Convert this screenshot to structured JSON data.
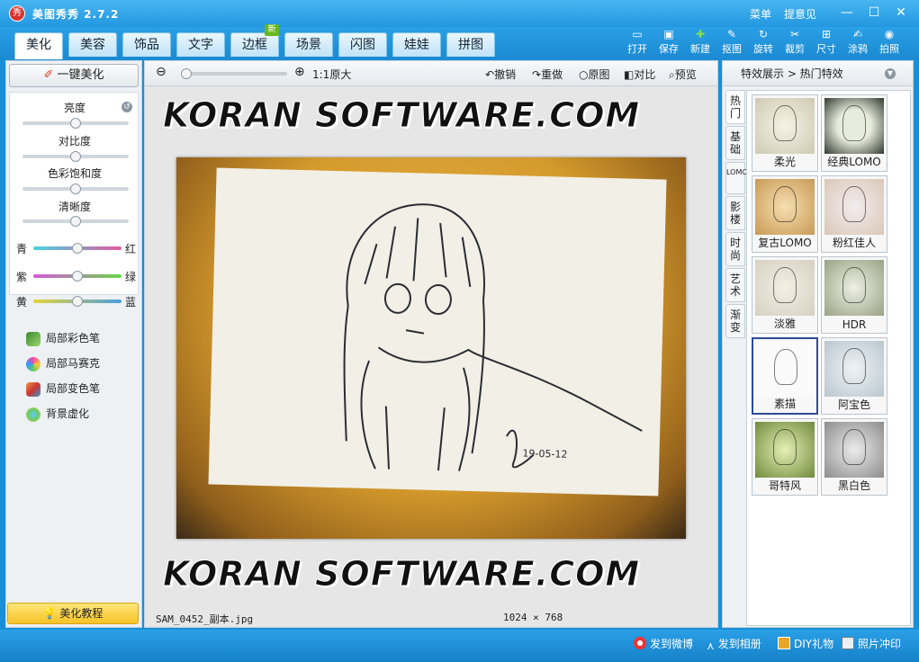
{
  "window": {
    "title": "美图秀秀 2.7.2",
    "logo_text": "秀",
    "menu_label": "菜单",
    "feedback_label": "提意见",
    "minimize": "—",
    "maximize": "☐",
    "close": "✕"
  },
  "tabs": [
    {
      "label": "美化"
    },
    {
      "label": "美容"
    },
    {
      "label": "饰品"
    },
    {
      "label": "文字"
    },
    {
      "label": "边框"
    },
    {
      "label": "场景"
    },
    {
      "label": "闪图"
    },
    {
      "label": "娃娃"
    },
    {
      "label": "拼图"
    }
  ],
  "new_badge": "新",
  "toolbar": {
    "open": "打开",
    "save": "保存",
    "new": "新建",
    "cutout": "抠图",
    "rotate": "旋转",
    "crop": "裁剪",
    "size": "尺寸",
    "doodle": "涂鸦",
    "photo": "拍照"
  },
  "left": {
    "one_key": "一键美化",
    "brightness": "亮度",
    "contrast": "对比度",
    "saturation": "色彩饱和度",
    "sharpness": "清晰度",
    "cyan": "青",
    "red": "红",
    "purple": "紫",
    "green": "绿",
    "yellow": "黄",
    "blue": "蓝",
    "tools": [
      "局部彩色笔",
      "局部马赛克",
      "局部变色笔",
      "背景虚化"
    ],
    "tutorial": "美化教程",
    "levels": {
      "brightness": 0.5,
      "contrast": 0.5,
      "saturation": 0.5,
      "sharpness": 0.5,
      "cyan_red": 0.5,
      "purple_green": 0.5,
      "yellow_blue": 0.5
    }
  },
  "center": {
    "zoom_label": "1:1原大",
    "undo": "撤销",
    "redo": "重做",
    "original": "原图",
    "compare": "对比",
    "preview": "预览",
    "watermark": "KORAN SOFTWARE.COM",
    "signature": "19-05-12",
    "filename": "SAM_0452_副本.jpg",
    "dims": "1024 × 768"
  },
  "right": {
    "header": "特效展示 > 热门特效",
    "vtabs": [
      "热门",
      "基础",
      "LOMO",
      "影楼",
      "时尚",
      "艺术",
      "渐变"
    ],
    "effects": [
      "柔光",
      "经典LOMO",
      "复古LOMO",
      "粉红佳人",
      "淡雅",
      "HDR",
      "素描",
      "阿宝色",
      "哥特风",
      "黑白色"
    ],
    "selected_effect": "素描"
  },
  "status": {
    "weibo": "发到微博",
    "album": "发到相册",
    "diy": "DIY礼物",
    "print": "照片冲印"
  },
  "colors": {
    "brand_blue": "#1a8fd6",
    "accent_yellow": "#f7c326",
    "new_green": "#67b81f"
  }
}
